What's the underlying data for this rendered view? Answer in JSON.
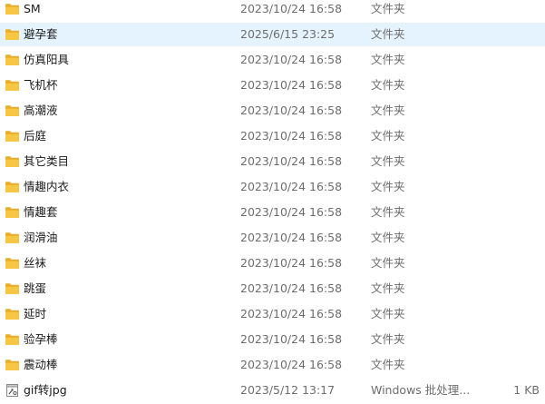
{
  "file_list": {
    "selected_index": 1,
    "items": [
      {
        "name": "SM",
        "date": "2023/10/24 16:58",
        "type": "文件夹",
        "size": "",
        "icon": "folder-icon"
      },
      {
        "name": "避孕套",
        "date": "2025/6/15 23:25",
        "type": "文件夹",
        "size": "",
        "icon": "folder-icon"
      },
      {
        "name": "仿真阳具",
        "date": "2023/10/24 16:58",
        "type": "文件夹",
        "size": "",
        "icon": "folder-icon"
      },
      {
        "name": "飞机杯",
        "date": "2023/10/24 16:58",
        "type": "文件夹",
        "size": "",
        "icon": "folder-icon"
      },
      {
        "name": "高潮液",
        "date": "2023/10/24 16:58",
        "type": "文件夹",
        "size": "",
        "icon": "folder-icon"
      },
      {
        "name": "后庭",
        "date": "2023/10/24 16:58",
        "type": "文件夹",
        "size": "",
        "icon": "folder-icon"
      },
      {
        "name": "其它类目",
        "date": "2023/10/24 16:58",
        "type": "文件夹",
        "size": "",
        "icon": "folder-icon"
      },
      {
        "name": "情趣内衣",
        "date": "2023/10/24 16:58",
        "type": "文件夹",
        "size": "",
        "icon": "folder-icon"
      },
      {
        "name": "情趣套",
        "date": "2023/10/24 16:58",
        "type": "文件夹",
        "size": "",
        "icon": "folder-icon"
      },
      {
        "name": "润滑油",
        "date": "2023/10/24 16:58",
        "type": "文件夹",
        "size": "",
        "icon": "folder-icon"
      },
      {
        "name": "丝袜",
        "date": "2023/10/24 16:58",
        "type": "文件夹",
        "size": "",
        "icon": "folder-icon"
      },
      {
        "name": "跳蛋",
        "date": "2023/10/24 16:58",
        "type": "文件夹",
        "size": "",
        "icon": "folder-icon"
      },
      {
        "name": "延时",
        "date": "2023/10/24 16:58",
        "type": "文件夹",
        "size": "",
        "icon": "folder-icon"
      },
      {
        "name": "验孕棒",
        "date": "2023/10/24 16:58",
        "type": "文件夹",
        "size": "",
        "icon": "folder-icon"
      },
      {
        "name": "震动棒",
        "date": "2023/10/24 16:58",
        "type": "文件夹",
        "size": "",
        "icon": "folder-icon"
      },
      {
        "name": "gif转jpg",
        "date": "2023/5/12 13:17",
        "type": "Windows 批处理...",
        "size": "1 KB",
        "icon": "batch-file-icon"
      }
    ]
  },
  "colors": {
    "folder_front": "#f7c744",
    "folder_back": "#e8ae2a",
    "selected_row": "#e5f3ff",
    "secondary_text": "#6d6d6d"
  }
}
